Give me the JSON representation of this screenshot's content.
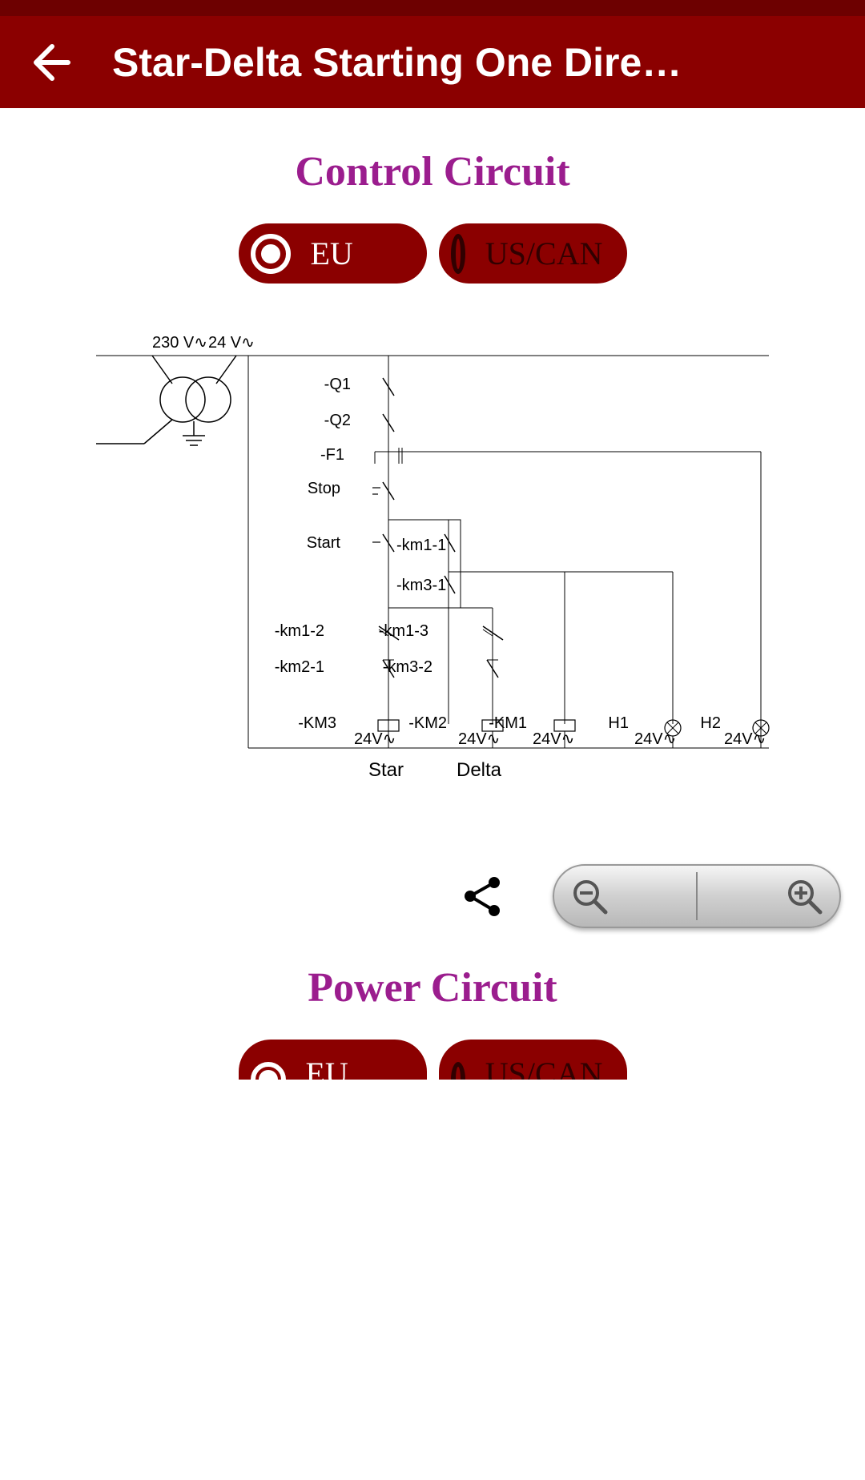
{
  "header": {
    "title": "Star-Delta Starting One Dire…"
  },
  "sections": {
    "control": {
      "title": "Control Circuit",
      "toggles": {
        "eu": "EU",
        "uscan": "US/CAN"
      }
    },
    "power": {
      "title": "Power Circuit",
      "toggles": {
        "eu": "EU",
        "uscan": "US/CAN"
      }
    }
  },
  "diagram": {
    "voltages": {
      "v1": "230 V∿",
      "v2": "24 V∿"
    },
    "labels": {
      "q1": "-Q1",
      "q2": "-Q2",
      "f1": "-F1",
      "stop": "Stop",
      "start": "Start",
      "km1_1": "-km1-1",
      "km3_1": "-km3-1",
      "km1_2": "-km1-2",
      "km1_3": "-km1-3",
      "km2_1": "-km2-1",
      "km3_2": "-km3-2",
      "KM3": "-KM3",
      "KM2": "-KM2",
      "KM1": "-KM1",
      "H1": "H1",
      "H2": "H2",
      "out24": "24V∿",
      "star": "Star",
      "delta": "Delta"
    }
  }
}
